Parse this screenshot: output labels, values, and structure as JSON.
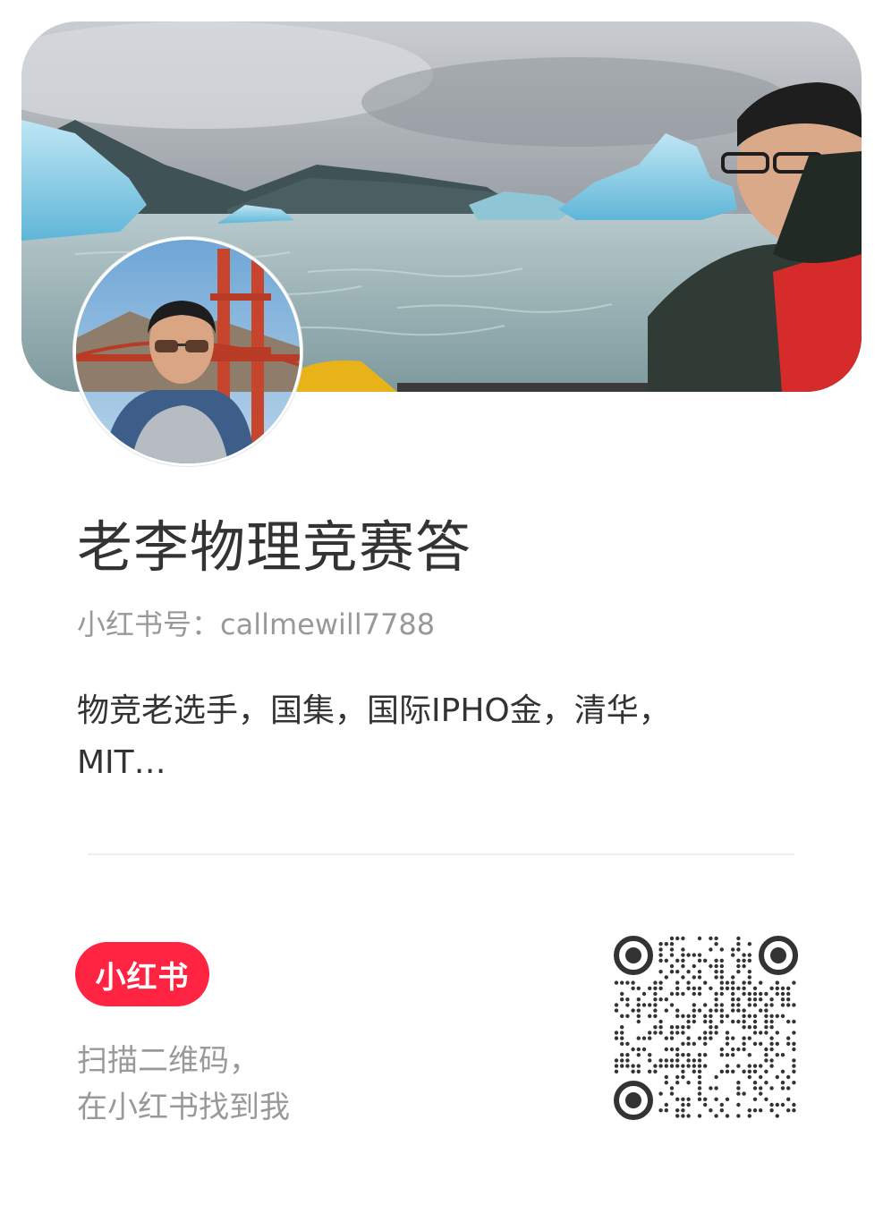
{
  "profile": {
    "name": "老李物理竞赛答",
    "account_label": "小红书号：",
    "account_id": "callmewill7788",
    "bio_line1": "物竞老选手，国集，国际IPHO金，清华，",
    "bio_line2": "MIT…"
  },
  "brand": {
    "logo_text": "小红书",
    "brand_color": "#ff2442"
  },
  "scan_prompt": {
    "line1": "扫描二维码，",
    "line2": "在小红书找到我"
  },
  "icons": {
    "banner": "banner-photo",
    "avatar": "avatar-photo",
    "qr": "qr-code-icon"
  }
}
